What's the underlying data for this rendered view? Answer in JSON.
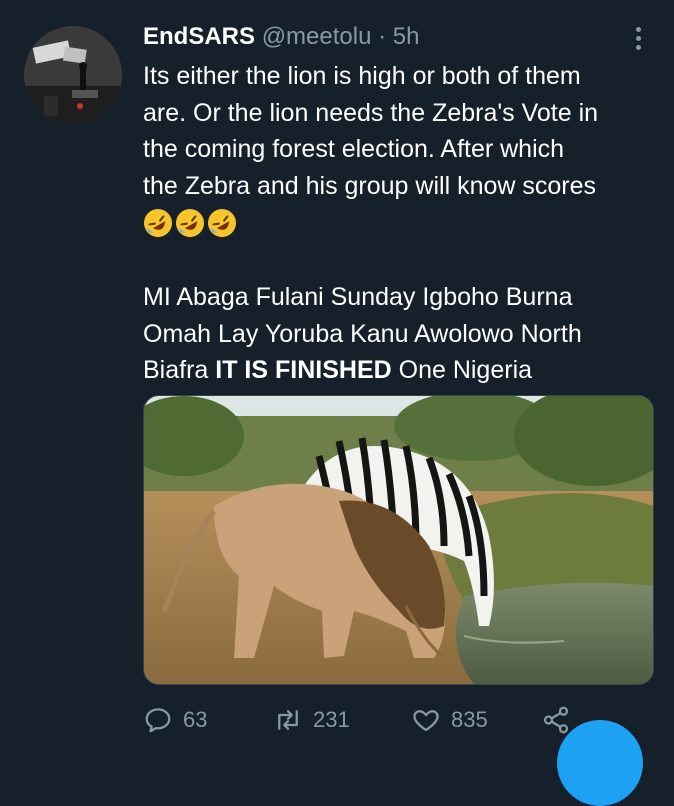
{
  "tweet": {
    "display_name": "EndSARS",
    "handle": "@meetolu",
    "separator": "·",
    "time": "5h",
    "text_lines": [
      "Its either the lion is high or both of them",
      "are. Or the lion needs the Zebra's Vote in",
      "the coming forest election. After which",
      "the Zebra and his group will know scores"
    ],
    "emoji_names": [
      "rolling-on-floor-laughing-icon",
      "rolling-on-floor-laughing-icon",
      "rolling-on-floor-laughing-icon"
    ],
    "paragraph2_line1": "MI Abaga Fulani Sunday Igboho Burna",
    "paragraph2_line2": "Omah Lay Yoruba Kanu Awolowo North",
    "paragraph2_line3_start": "Biafra",
    "paragraph2_line3_bold": "IT IS FINISHED",
    "paragraph2_line3_end": "One Nigeria"
  },
  "actions": {
    "replies": "63",
    "retweets": "231",
    "likes": "835"
  },
  "colors": {
    "background": "#15202b",
    "text": "#ffffff",
    "muted": "#8899a6",
    "accent": "#1da1f2"
  }
}
